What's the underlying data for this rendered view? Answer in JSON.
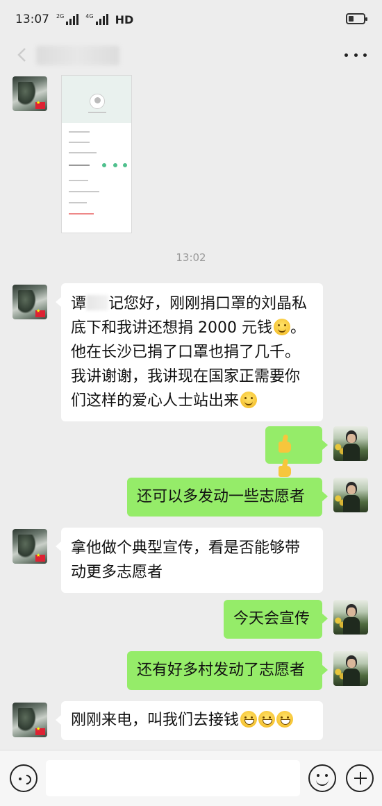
{
  "status_bar": {
    "time": "13:07",
    "network1": "2G",
    "network2": "4G",
    "hd": "HD",
    "battery_level": 0.35
  },
  "chat": {
    "timestamp": "13:02",
    "messages": [
      {
        "from": "other",
        "type": "image"
      },
      {
        "from": "other",
        "text_a": "谭",
        "text_b": "记您好，刚刚捐口罩的刘晶私底下和我讲还想捐 2000 元钱",
        "text_c": "。他在长沙已捐了口罩也捐了几千。我讲谢谢，我讲现在国家正需要你们这样的爱心人士站出来"
      },
      {
        "from": "me",
        "type": "thumbs"
      },
      {
        "from": "me",
        "text": "还可以多发动一些志愿者"
      },
      {
        "from": "other",
        "text": "拿他做个典型宣传，看是否能够带动更多志愿者"
      },
      {
        "from": "me",
        "text": "今天会宣传"
      },
      {
        "from": "me",
        "text": "还有好多村发动了志愿者"
      },
      {
        "from": "other",
        "text": "刚刚来电，叫我们去接钱"
      }
    ]
  },
  "input_bar": {
    "placeholder": ""
  },
  "icons": {
    "back": "back-arrow-icon",
    "more": "more-dots-icon",
    "voice": "voice-icon",
    "emoji": "emoji-icon",
    "plus": "plus-icon"
  },
  "colors": {
    "my_bubble": "#95ec69",
    "other_bubble": "#ffffff",
    "background": "#ededed"
  }
}
